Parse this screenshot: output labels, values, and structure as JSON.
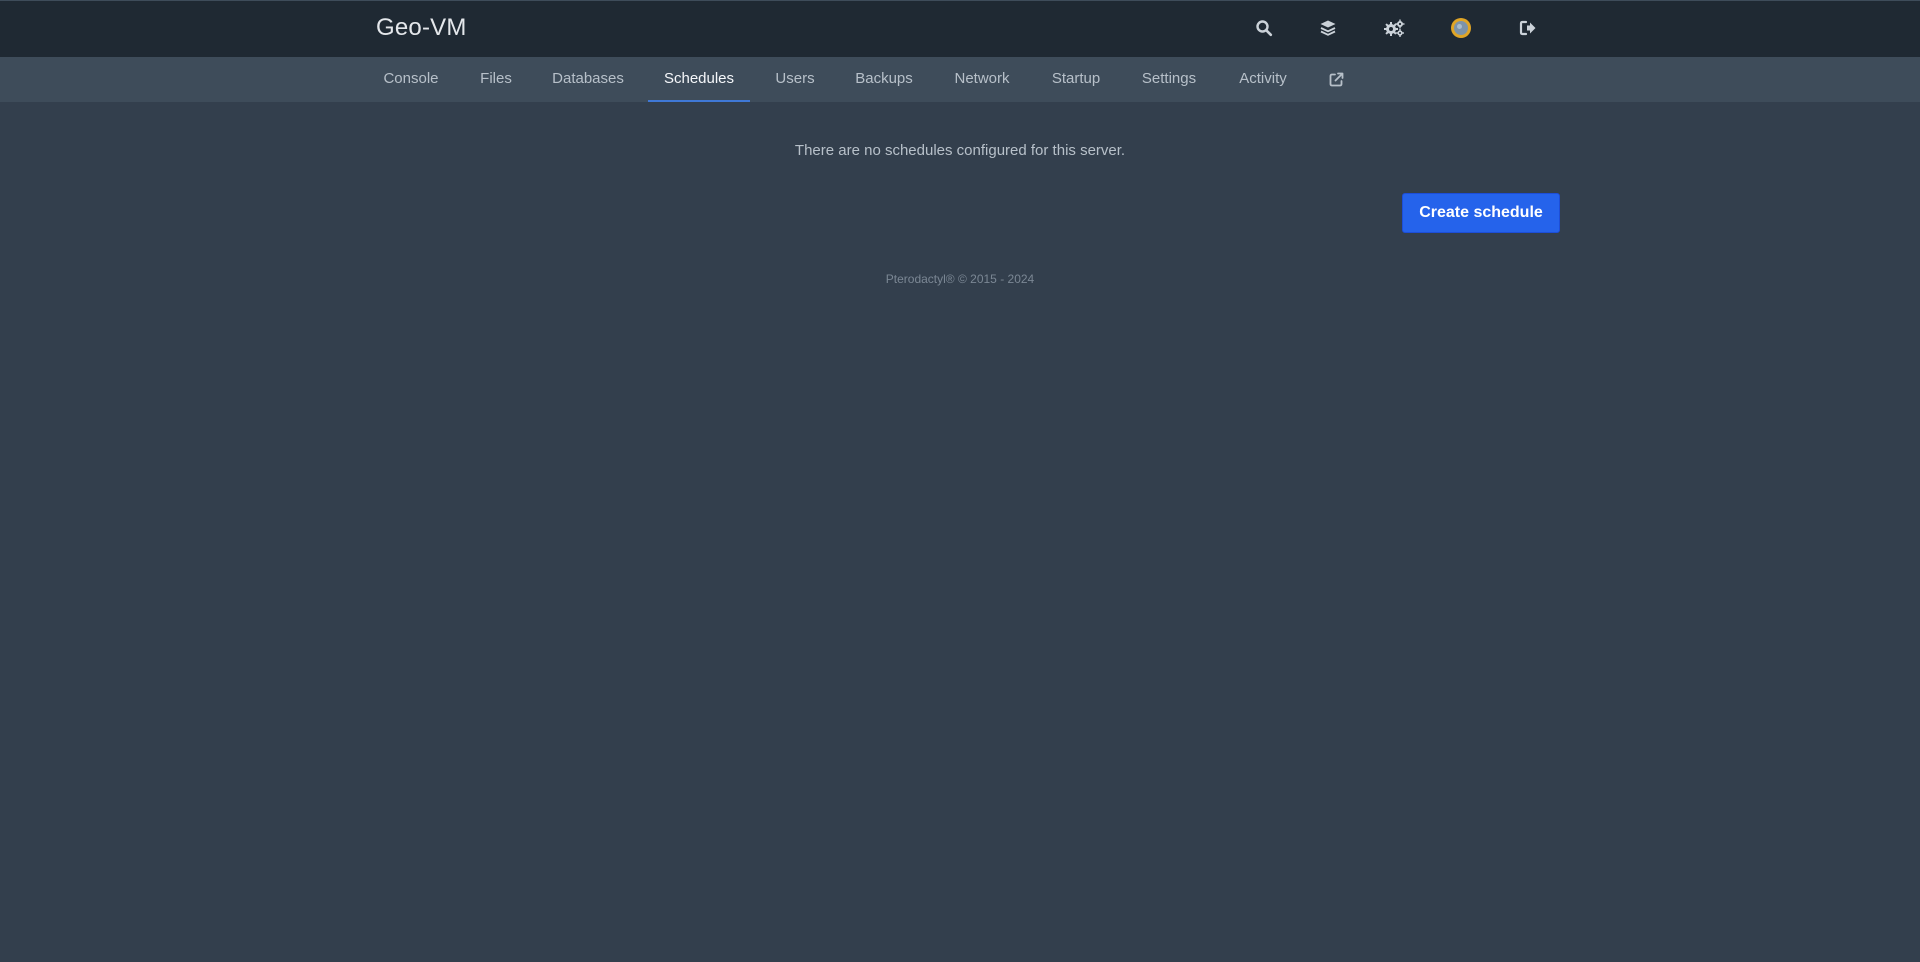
{
  "app": {
    "server_name": "Geo-VM"
  },
  "topbar": {
    "icons": [
      {
        "name": "search-icon"
      },
      {
        "name": "layers-icon"
      },
      {
        "name": "cogs-icon"
      },
      {
        "name": "avatar"
      },
      {
        "name": "sign-out-icon"
      }
    ]
  },
  "nav": {
    "tabs": [
      {
        "label": "Console"
      },
      {
        "label": "Files"
      },
      {
        "label": "Databases"
      },
      {
        "label": "Schedules",
        "active": true
      },
      {
        "label": "Users"
      },
      {
        "label": "Backups"
      },
      {
        "label": "Network"
      },
      {
        "label": "Startup"
      },
      {
        "label": "Settings"
      },
      {
        "label": "Activity"
      }
    ],
    "external_link_icon": "external-link-icon"
  },
  "main": {
    "empty_message": "There are no schedules configured for this server.",
    "create_button_label": "Create schedule"
  },
  "footer": {
    "text": "Pterodactyl® © 2015 - 2024"
  },
  "colors": {
    "accent": "#2563eb",
    "tab_underline": "#3f78d6",
    "topbar_bg": "#1f2933",
    "subnav_bg": "#3e4c5a",
    "page_bg": "#333f4d"
  }
}
